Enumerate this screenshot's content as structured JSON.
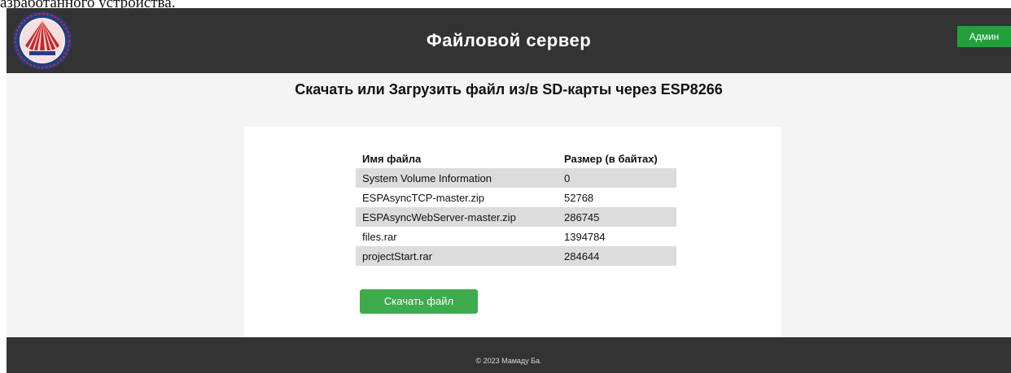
{
  "document_fragment": "азработанного устройства.",
  "header": {
    "title": "Файловой сервер",
    "admin_label": "Админ"
  },
  "main": {
    "heading": "Скачать или Загрузить файл из/в SD-карты через ESP8266",
    "table": {
      "columns": [
        "Имя файла",
        "Размер (в байтах)"
      ],
      "rows": [
        {
          "name": "System Volume Information",
          "size": "0"
        },
        {
          "name": "ESPAsyncTCP-master.zip",
          "size": "52768"
        },
        {
          "name": "ESPAsyncWebServer-master.zip",
          "size": "286745"
        },
        {
          "name": "files.rar",
          "size": "1394784"
        },
        {
          "name": "projectStart.rar",
          "size": "284644"
        }
      ]
    },
    "download_label": "Скачать файл"
  },
  "footer": {
    "text": "© 2023 Мамаду Ба."
  },
  "colors": {
    "header_bg": "#333333",
    "accent_green": "#22a03a",
    "button_green": "#3eab4c",
    "logo_red": "#c8272c",
    "logo_blue": "#1f3f86"
  },
  "icons": {
    "logo": "university-emblem-icon"
  }
}
